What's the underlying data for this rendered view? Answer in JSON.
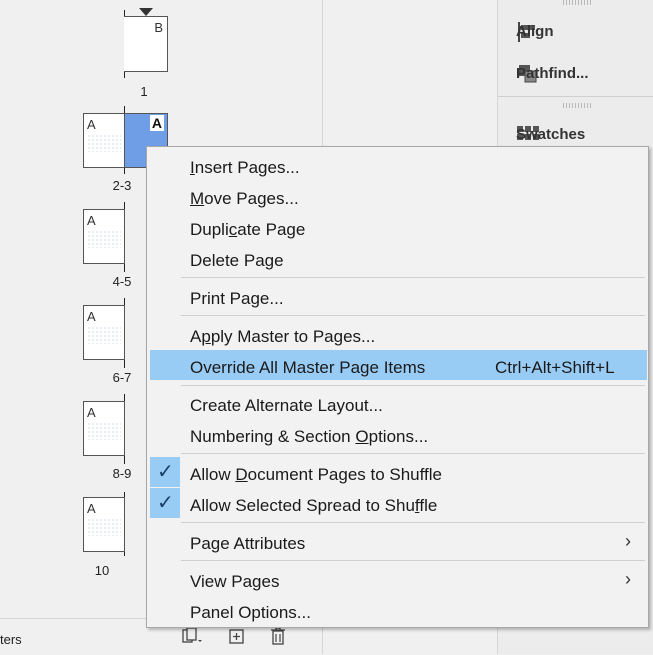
{
  "pages_panel": {
    "bottom_label": "ters",
    "pages": [
      {
        "label": "1",
        "master_letter": "B"
      },
      {
        "label": "2-3",
        "left_letter": "A",
        "right_letter": "A"
      },
      {
        "label": "4-5",
        "left_letter": "A"
      },
      {
        "label": "6-7",
        "left_letter": "A"
      },
      {
        "label": "8-9",
        "left_letter": "A"
      },
      {
        "label": "10",
        "left_letter": "A"
      }
    ]
  },
  "right_panel": {
    "items": [
      {
        "label": "Align",
        "icon": "align-icon"
      },
      {
        "label": "Pathfind...",
        "icon": "pathfinder-icon"
      },
      {
        "label": "Swatches",
        "icon": "swatches-icon"
      }
    ]
  },
  "context_menu": {
    "items": [
      {
        "pre": "",
        "ul": "I",
        "post": "nsert Pages..."
      },
      {
        "pre": "",
        "ul": "M",
        "post": "ove Pages..."
      },
      {
        "pre": "Dupli",
        "ul": "c",
        "post": "ate Page"
      },
      {
        "pre": "Delete Page",
        "ul": "",
        "post": ""
      },
      {
        "pre": "Print Page...",
        "ul": "",
        "post": ""
      },
      {
        "pre": "A",
        "ul": "p",
        "post": "ply Master to Pages..."
      },
      {
        "pre": "Override All Master Page Items",
        "ul": "",
        "post": "",
        "shortcut": "Ctrl+Alt+Shift+L"
      },
      {
        "pre": "Create Alternate Layout...",
        "ul": "",
        "post": ""
      },
      {
        "pre": "Numbering & Section ",
        "ul": "O",
        "post": "ptions..."
      },
      {
        "pre": "Allow ",
        "ul": "D",
        "post": "ocument Pages to Shuffle"
      },
      {
        "pre": "Allow Selected Spread to Shu",
        "ul": "f",
        "post": "fle"
      },
      {
        "pre": "Page Attributes",
        "ul": "",
        "post": ""
      },
      {
        "pre": "View Pages",
        "ul": "",
        "post": ""
      },
      {
        "pre": "Panel Options...",
        "ul": "",
        "post": ""
      }
    ],
    "checkmark": "✓",
    "submenu_arrow": "›"
  },
  "colors": {
    "highlight": "#99ccf5",
    "selected_page": "#6f9ee6"
  }
}
